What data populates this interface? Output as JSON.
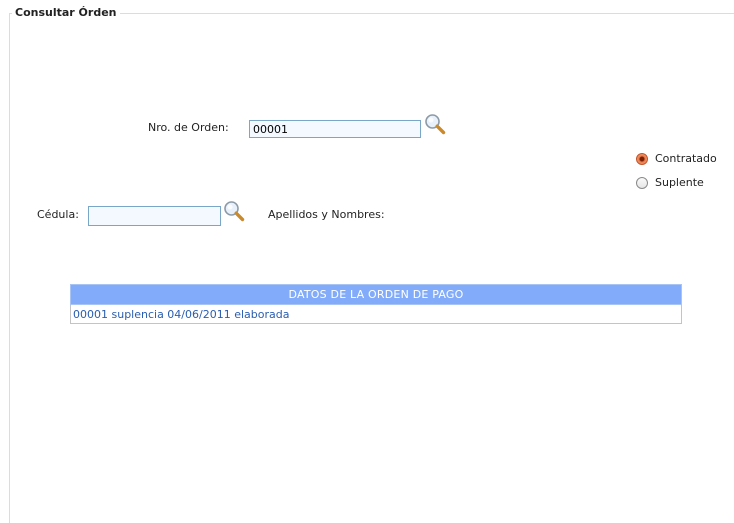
{
  "form": {
    "title": "Consultar Órden"
  },
  "orden": {
    "label": "Nro. de Orden:",
    "value": "00001"
  },
  "cedula": {
    "label": "Cédula:",
    "value": ""
  },
  "apellidos": {
    "label": "Apellidos y Nombres:"
  },
  "tipo": {
    "options": [
      {
        "label": "Contratado",
        "selected": true
      },
      {
        "label": "Suplente",
        "selected": false
      }
    ]
  },
  "table": {
    "header": "DATOS DE LA ORDEN DE PAGO",
    "rows": [
      "00001 suplencia 04/06/2011 elaborada"
    ]
  },
  "icons": {
    "search": "magnifier-search-icon"
  }
}
